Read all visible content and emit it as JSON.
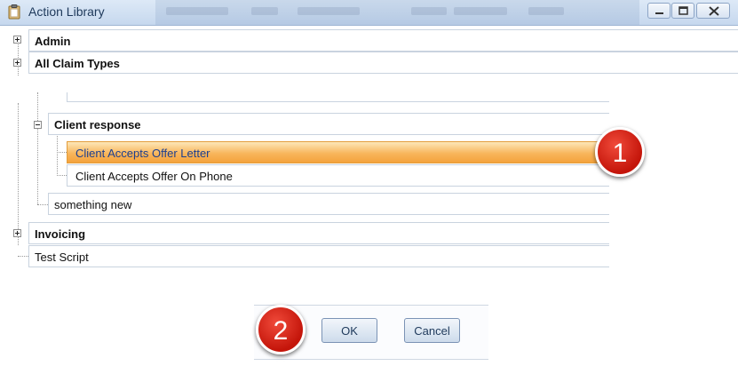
{
  "window": {
    "title": "Action Library",
    "title_icon": "clipboard-icon",
    "controls": [
      "minimize-icon",
      "restore-icon",
      "close-icon"
    ]
  },
  "tree": {
    "nodes": [
      {
        "label": "Admin",
        "bold": true,
        "toggle": "plus"
      },
      {
        "label": "All Claim Types",
        "bold": true,
        "toggle": "plus"
      },
      {
        "label": "Client response",
        "bold": true,
        "toggle": "minus"
      },
      {
        "label": "Client Accepts Offer Letter",
        "selected": true
      },
      {
        "label": "Client Accepts Offer On Phone"
      },
      {
        "label": "something new"
      },
      {
        "label": "Invoicing",
        "bold": true,
        "toggle": "plus"
      },
      {
        "label": "Test Script"
      }
    ],
    "selected_color": "#f6a84a"
  },
  "callouts": {
    "one": "1",
    "two": "2",
    "color": "#d8231a"
  },
  "buttons": {
    "ok": "OK",
    "cancel": "Cancel"
  }
}
